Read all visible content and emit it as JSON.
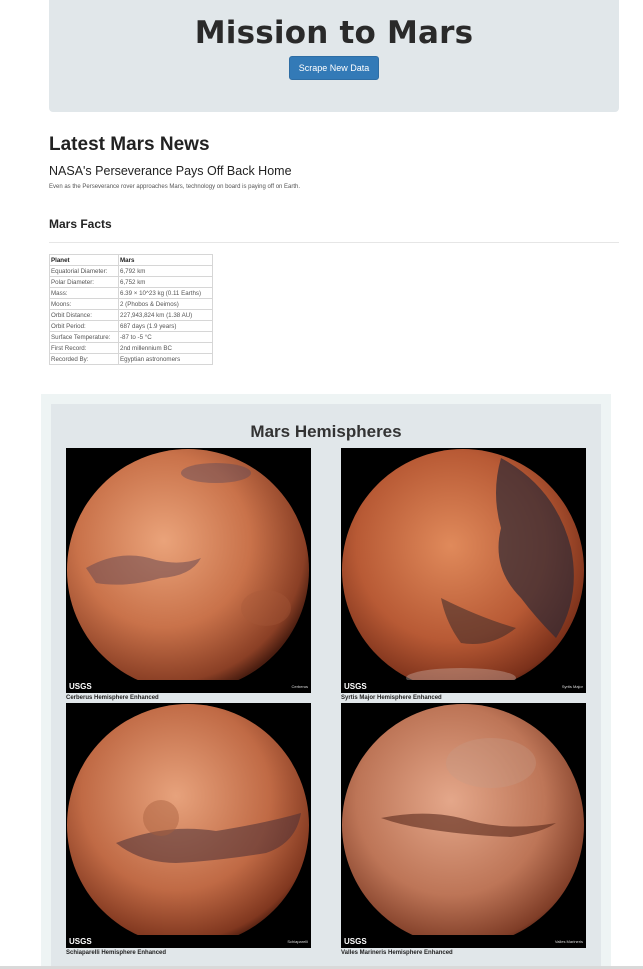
{
  "header": {
    "title": "Mission to Mars",
    "scrape_button_label": "Scrape New Data"
  },
  "news": {
    "section_title": "Latest Mars News",
    "headline": "NASA's Perseverance Pays Off Back Home",
    "teaser": "Even as the Perseverance rover approaches Mars, technology on board is paying off on Earth."
  },
  "facts": {
    "section_title": "Mars Facts",
    "header": [
      "Planet",
      "Mars"
    ],
    "rows": [
      [
        "Equatorial Diameter:",
        "6,792 km"
      ],
      [
        "Polar Diameter:",
        "6,752 km"
      ],
      [
        "Mass:",
        "6.39 × 10^23 kg (0.11 Earths)"
      ],
      [
        "Moons:",
        "2 (Phobos & Deimos)"
      ],
      [
        "Orbit Distance:",
        "227,943,824 km (1.38 AU)"
      ],
      [
        "Orbit Period:",
        "687 days (1.9 years)"
      ],
      [
        "Surface Temperature:",
        "-87 to -5 °C"
      ],
      [
        "First Record:",
        "2nd millennium BC"
      ],
      [
        "Recorded By:",
        "Egyptian astronomers"
      ]
    ]
  },
  "hemispheres": {
    "section_title": "Mars Hemispheres",
    "items": [
      {
        "caption": "Cerberus Hemisphere Enhanced",
        "image_label": "Cerberus",
        "logo": "USGS"
      },
      {
        "caption": "Syrtis Major Hemisphere Enhanced",
        "image_label": "Syrtis Major",
        "logo": "USGS"
      },
      {
        "caption": "Schiaparelli Hemisphere Enhanced",
        "image_label": "Schiaparelli",
        "logo": "USGS"
      },
      {
        "caption": "Valles Marineris Hemisphere Enhanced",
        "image_label": "Valles Marineris",
        "logo": "USGS"
      }
    ]
  },
  "colors": {
    "accent_button": "#337ab7",
    "jumbotron_bg": "#e1e7ea",
    "mars_light": "#d98a5f",
    "mars_dark": "#6b3221"
  }
}
